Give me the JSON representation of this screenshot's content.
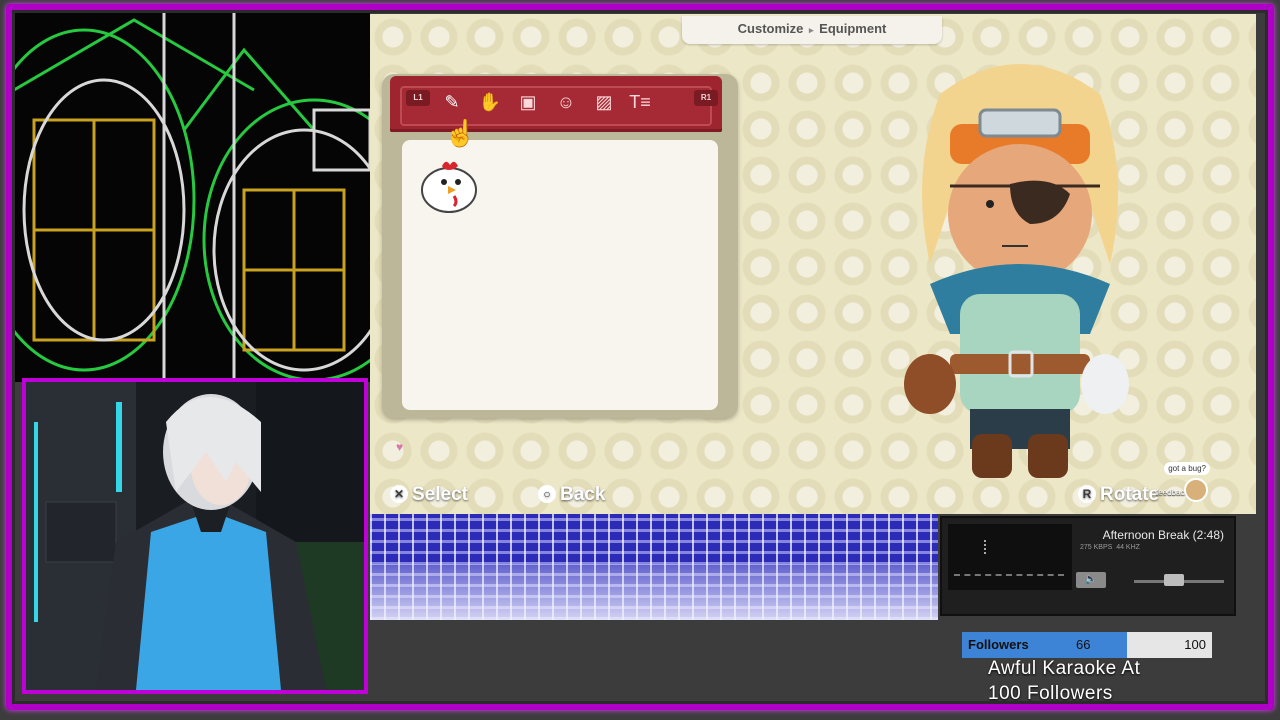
{
  "game": {
    "breadcrumb": {
      "first": "Customize",
      "second": "Equipment"
    },
    "tabs": {
      "left_button": "L1",
      "right_button": "R1",
      "icons": [
        "spray-paint-icon",
        "hand-wave-icon",
        "portrait-icon",
        "face-icon",
        "image-icon",
        "text-icon"
      ]
    },
    "item_icon": "chicken-icon",
    "prompts": {
      "select_glyph": "✕",
      "select_label": "Select",
      "back_glyph": "○",
      "back_label": "Back",
      "rotate_glyph": "R",
      "rotate_label": "Rotate"
    },
    "feedback": {
      "bubble": "got a bug?",
      "label": "feedback"
    }
  },
  "player": {
    "title": "Afternoon Break (2:48)",
    "bitrate": "275 KBPS",
    "samplerate": "44 KHZ"
  },
  "goal": {
    "label": "Followers",
    "current": "66",
    "target": "100",
    "progress": 0.66,
    "message_line1": "Awful Karaoke At",
    "message_line2": "100 Followers"
  },
  "colors": {
    "frame": "#b000c8",
    "tab_bar": "#9e2430",
    "goal_fill": "#3d84d6"
  }
}
